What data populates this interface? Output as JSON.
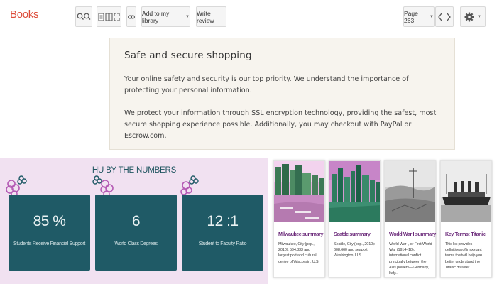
{
  "toolbar": {
    "logo": "Books",
    "add_library": "Add to my library",
    "write_review": "Write review",
    "page": "Page 263"
  },
  "notice": {
    "title": "Safe and secure shopping",
    "p1": "Your online safety and security is our top priority. We understand the importance of protecting your personal information.",
    "p2": "We protect your information through SSL encryption technology, providing the safest, most secure shopping experience possible. Additionally, you may checkout with PayPal or Escrow.com."
  },
  "stats": {
    "heading": "HU BY THE NUMBERS",
    "items": [
      {
        "value": "85 %",
        "label": "Students Receive Financial Support"
      },
      {
        "value": "6",
        "label": "World Class Degrees"
      },
      {
        "value": "12 :1",
        "label": "Student to Faculty Ratio"
      }
    ]
  },
  "articles": [
    {
      "title": "Milwaukee summary",
      "desc": "Milwaukee, City (pop., 2010): 594,833 and largest port and cultural centre of Wisconsin, U.S."
    },
    {
      "title": "Seattle summary",
      "desc": "Seattle, City (pop., 2010): 608,660 and seaport, Washington, U.S."
    },
    {
      "title": "World War I summary",
      "desc": "World War I, or First World War (1914–18), international conflict principally between the Axis powers—Germany, Italy..."
    },
    {
      "title": "Key Terms: Titanic",
      "desc": "This list provides definitions of important terms that will help you better understand the Titanic disaster."
    }
  ],
  "colors": {
    "logo": "#dd4b39",
    "stats_bg": "#f1e1f1",
    "stat_card": "#1f5a66",
    "article_title": "#6b2a7a"
  }
}
